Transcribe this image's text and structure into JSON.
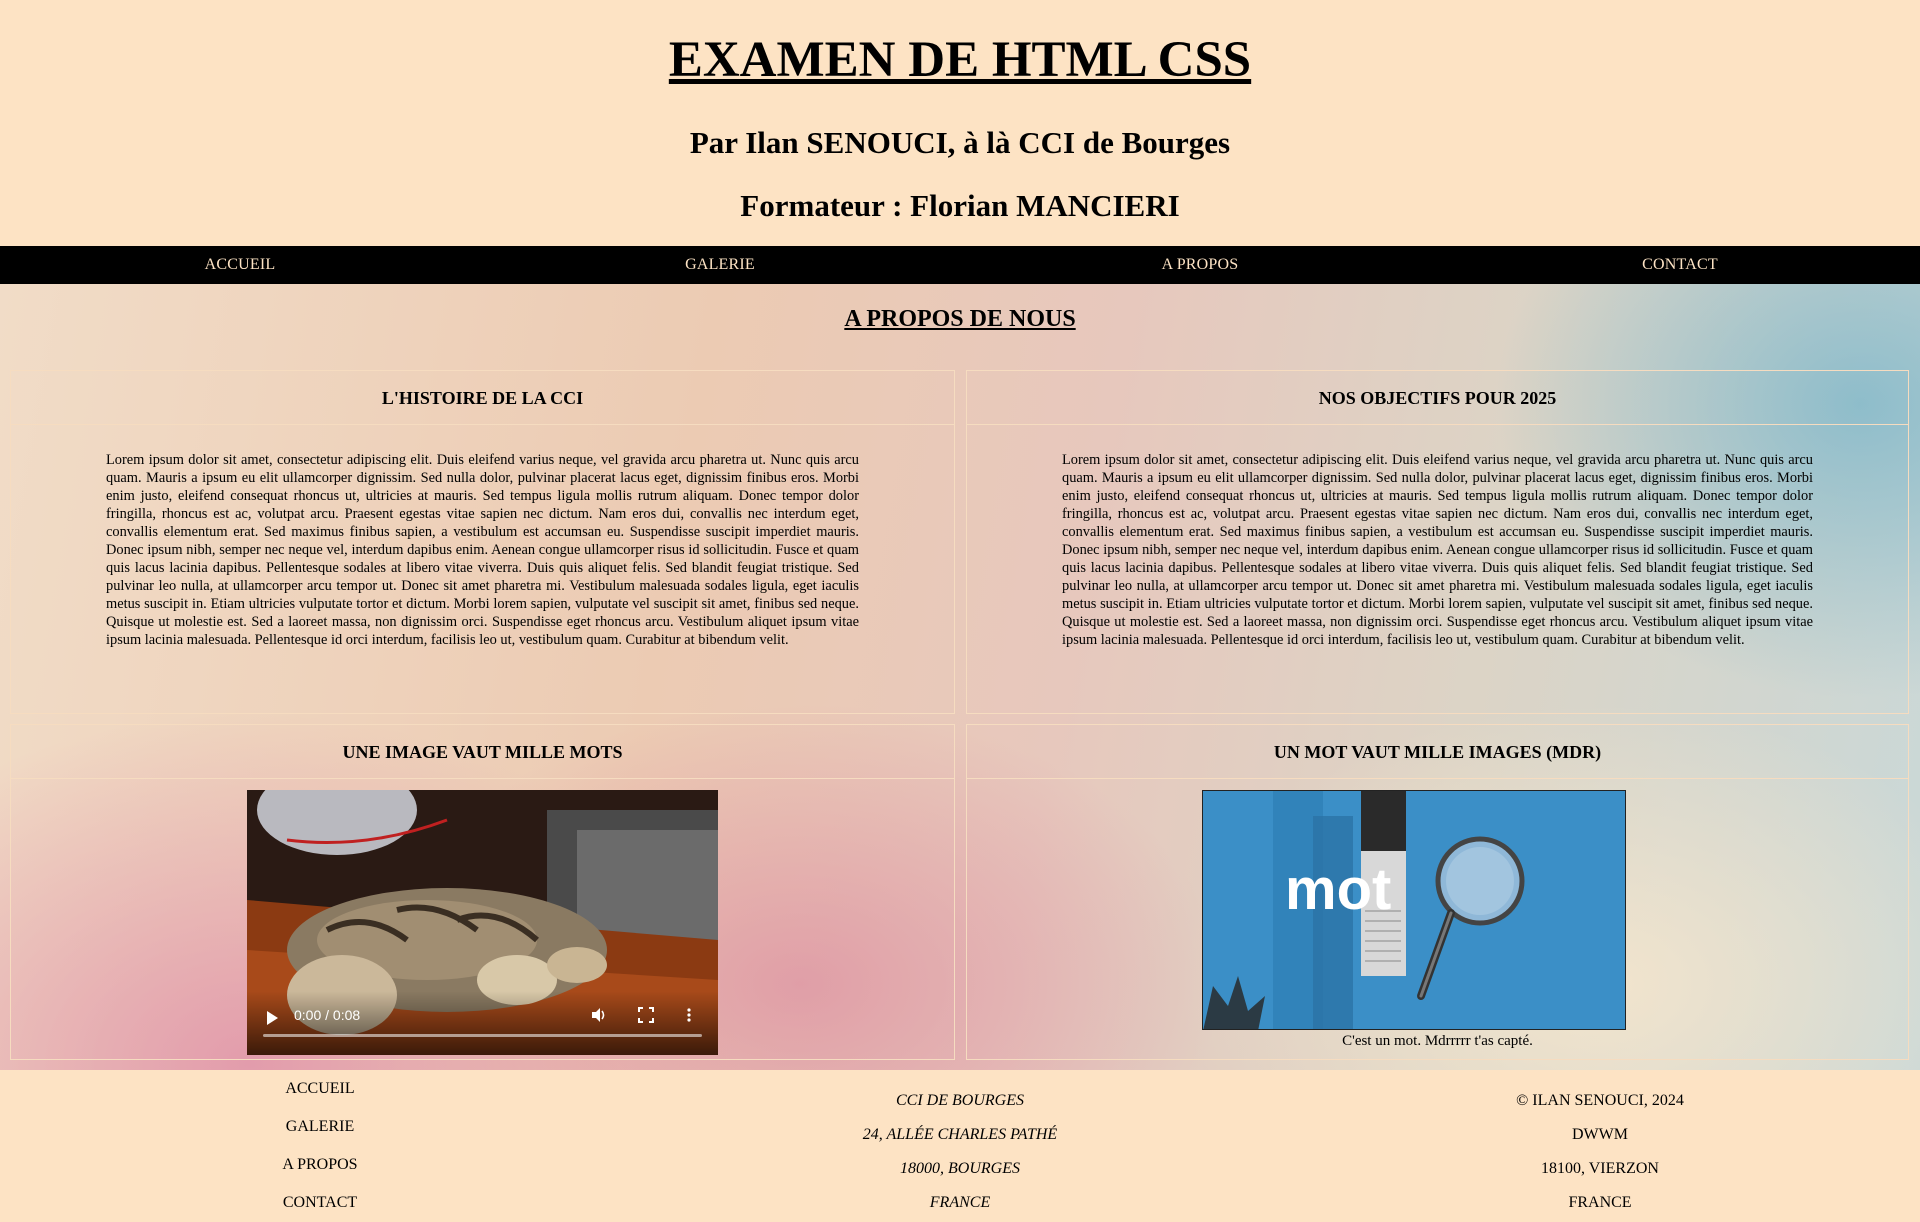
{
  "header": {
    "title": "EXAMEN DE HTML CSS",
    "subtitle": "Par Ilan SENOUCI, à là CCI de Bourges",
    "trainer": "Formateur : Florian MANCIERI"
  },
  "nav": {
    "items": [
      "ACCUEIL",
      "GALERIE",
      "A PROPOS",
      "CONTACT"
    ]
  },
  "main": {
    "title": "A PROPOS DE NOUS",
    "cards": [
      {
        "heading": "L'HISTOIRE DE LA CCI",
        "text": "Lorem ipsum dolor sit amet, consectetur adipiscing elit. Duis eleifend varius neque, vel gravida arcu pharetra ut. Nunc quis arcu quam. Mauris a ipsum eu elit ullamcorper dignissim. Sed nulla dolor, pulvinar placerat lacus eget, dignissim finibus eros. Morbi enim justo, eleifend consequat rhoncus ut, ultricies at mauris. Sed tempus ligula mollis rutrum aliquam. Donec tempor dolor fringilla, rhoncus est ac, volutpat arcu. Praesent egestas vitae sapien nec dictum. Nam eros dui, convallis nec interdum eget, convallis elementum erat. Sed maximus finibus sapien, a vestibulum est accumsan eu. Suspendisse suscipit imperdiet mauris. Donec ipsum nibh, semper nec neque vel, interdum dapibus enim. Aenean congue ullamcorper risus id sollicitudin. Fusce et quam quis lacus lacinia dapibus. Pellentesque sodales at libero vitae viverra. Duis quis aliquet felis. Sed blandit feugiat tristique. Sed pulvinar leo nulla, at ullamcorper arcu tempor ut. Donec sit amet pharetra mi. Vestibulum malesuada sodales ligula, eget iaculis metus suscipit in. Etiam ultricies vulputate tortor et dictum. Morbi lorem sapien, vulputate vel suscipit sit amet, finibus sed neque. Quisque ut molestie est. Sed a laoreet massa, non dignissim orci. Suspendisse eget rhoncus arcu. Vestibulum aliquet ipsum vitae ipsum lacinia malesuada. Pellentesque id orci interdum, facilisis leo ut, vestibulum quam. Curabitur at bibendum velit."
      },
      {
        "heading": "NOS OBJECTIFS POUR 2025",
        "text": "Lorem ipsum dolor sit amet, consectetur adipiscing elit. Duis eleifend varius neque, vel gravida arcu pharetra ut. Nunc quis arcu quam. Mauris a ipsum eu elit ullamcorper dignissim. Sed nulla dolor, pulvinar placerat lacus eget, dignissim finibus eros. Morbi enim justo, eleifend consequat rhoncus ut, ultricies at mauris. Sed tempus ligula mollis rutrum aliquam. Donec tempor dolor fringilla, rhoncus est ac, volutpat arcu. Praesent egestas vitae sapien nec dictum. Nam eros dui, convallis nec interdum eget, convallis elementum erat. Sed maximus finibus sapien, a vestibulum est accumsan eu. Suspendisse suscipit imperdiet mauris. Donec ipsum nibh, semper nec neque vel, interdum dapibus enim. Aenean congue ullamcorper risus id sollicitudin. Fusce et quam quis lacus lacinia dapibus. Pellentesque sodales at libero vitae viverra. Duis quis aliquet felis. Sed blandit feugiat tristique. Sed pulvinar leo nulla, at ullamcorper arcu tempor ut. Donec sit amet pharetra mi. Vestibulum malesuada sodales ligula, eget iaculis metus suscipit in. Etiam ultricies vulputate tortor et dictum. Morbi lorem sapien, vulputate vel suscipit sit amet, finibus sed neque. Quisque ut molestie est. Sed a laoreet massa, non dignissim orci. Suspendisse eget rhoncus arcu. Vestibulum aliquet ipsum vitae ipsum lacinia malesuada. Pellentesque id orci interdum, facilisis leo ut, vestibulum quam. Curabitur at bibendum velit."
      },
      {
        "heading": "UNE IMAGE VAUT MILLE MOTS",
        "video": {
          "time": "0:00 / 0:08",
          "icons": [
            "play-icon",
            "volume-icon",
            "fullscreen-icon",
            "more-options-icon"
          ]
        }
      },
      {
        "heading": "UN MOT VAUT MILLE IMAGES (MDR)",
        "image_word": "mot",
        "caption": "C'est un mot. Mdrrrrr t'as capté."
      }
    ]
  },
  "footer": {
    "links": [
      "ACCUEIL",
      "GALERIE",
      "A PROPOS",
      "CONTACT"
    ],
    "address": [
      "CCI DE BOURGES",
      "24, ALLÉE CHARLES PATHÉ",
      "18000, BOURGES",
      "FRANCE"
    ],
    "copyright": [
      "© ILAN SENOUCI, 2024",
      "DWWM",
      "18100, VIERZON",
      "FRANCE"
    ]
  },
  "colors": {
    "page_bg": "#fde3c4",
    "nav_bg": "#000000",
    "nav_text": "#fde3c4",
    "card_border": "#f6dcc0",
    "image_bg": "#3b8fc7"
  }
}
